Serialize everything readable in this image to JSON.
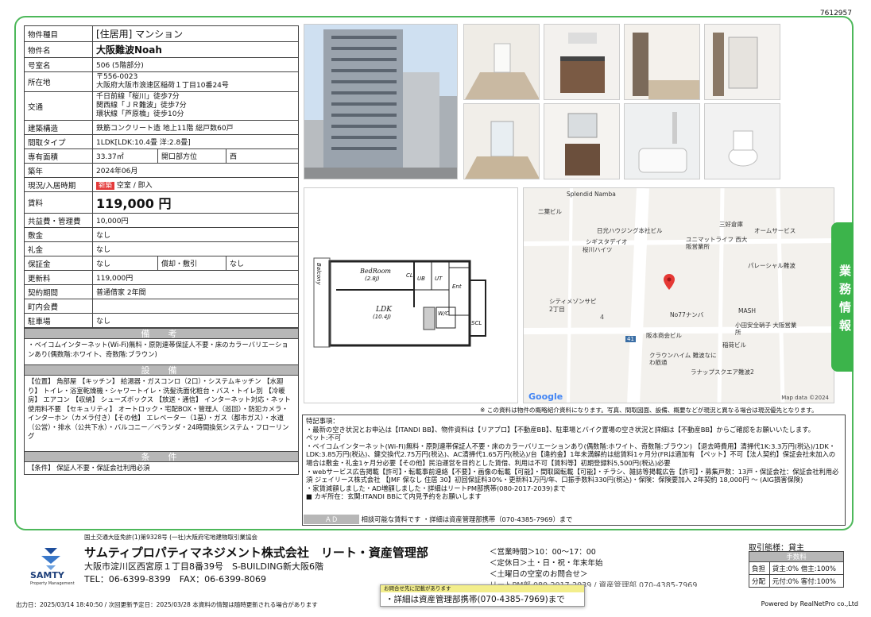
{
  "property_id": "7612957",
  "spec": {
    "rows": [
      {
        "k": "物件種目",
        "v": "[住居用] マンション"
      },
      {
        "k": "物件名",
        "v": "大阪難波Noah"
      },
      {
        "k": "号室名",
        "v": "506 (5階部分)"
      },
      {
        "k": "所在地",
        "v": "〒556-0023\n大阪府大阪市浪速区稲荷１丁目10番24号"
      },
      {
        "k": "交通",
        "v": "千日前線「桜川」徒歩7分\n関西線「ＪＲ難波」徒歩7分\n環状線「芦原橋」徒歩10分"
      },
      {
        "k": "建築構造",
        "v": "鉄筋コンクリート造 地上11階 総戸数60戸"
      },
      {
        "k": "間取タイプ",
        "v": "1LDK[LDK:10.4畳 洋:2.8畳]"
      }
    ],
    "area_label": "専有面積",
    "area": "33.37㎡",
    "dir_label": "開口部方位",
    "dir": "西",
    "built_label": "築年",
    "built": "2024年06月",
    "status_label": "現況/入居時期",
    "status_badge": "新築",
    "status": "空室 / 即入",
    "rent_label": "賃料",
    "rent": "119,000 円",
    "fee_label": "共益費・管理費",
    "fee": "10,000円",
    "deposit_label": "敷金",
    "deposit": "なし",
    "key_label": "礼金",
    "key": "なし",
    "hosho_label": "保証金",
    "hosho": "なし",
    "shokyaku_label": "償却・敷引",
    "shokyaku": "なし",
    "renew_label": "更新料",
    "renew": "119,000円",
    "contract_label": "契約期間",
    "contract": "普通借家 2年間",
    "town_label": "町内会費",
    "town": "",
    "parking_label": "駐車場",
    "parking": "なし"
  },
  "biko": {
    "title": "備　考",
    "text": "・ベイコムインターネット(Wi-Fi)無料・原則連帯保証人不要・床のカラーバリエーションあり(偶数階:ホワイト、奇数階:ブラウン)"
  },
  "setsubi": {
    "title": "設　備",
    "text": "【位置】 角部屋 【キッチン】 給湯器・ガスコンロ（2口）・システムキッチン 【水廻り】 トイレ・浴室乾燥機・シャワートイレ・洗髪洗面化粧台・バス・トイレ別 【冷暖房】 エアコン 【収納】 シューズボックス 【放送・通信】 インターネット対応・ネット使用料不要 【セキュリティ】 オートロック・宅配BOX・管理人（巡回）・防犯カメラ・インターホン（カメラ付き）【その他】 エレベーター（1基）・ガス（都市ガス）・水道（公営）・排水（公共下水）・バルコニー／ベランダ・24時間換気システム・フローリング"
  },
  "joken": {
    "title": "条　件",
    "text": "【条件】 保証人不要・保証会社利用必須"
  },
  "floorplan": {
    "bedroom": "BedRoom",
    "bedroom_size": "(2.8J)",
    "ldk": "LDK",
    "ldk_size": "(10.4J)",
    "cl": "CL",
    "ub": "UB",
    "ut": "UT",
    "ent": "Ent",
    "wc": "W/C",
    "scl": "SCL",
    "balcony": "Balcony"
  },
  "map": {
    "labels": [
      "Splendid Namba",
      "二葉ビル",
      "三好倉庫",
      "日光ハウジング本社ビル",
      "オームサービス",
      "シギスタデイオ",
      "ユニマットライフ 西大阪営業所",
      "桜川ハイツ",
      "パレーシャル難波",
      "シティメゾンサピ 2丁目",
      "No77ナンバ",
      "MASH",
      "阪本商会ビル",
      "小田安全硝子 大阪営業所",
      "稲荷ビル",
      "クラウンハイム 難波なにわ筋通",
      "ラナップスクエア難波2"
    ],
    "block": "4",
    "route": "41",
    "google": "Google",
    "credit": "Map data ©2024"
  },
  "disclaimer": "※ この資料は物件の概略紹介資料になります。写真、間取図面、設備、概要などが現況と異なる場合は現況優先となります。",
  "notes": {
    "title": "特記事項：",
    "lines": [
      "・最新の空き状況とお申込は【ITANDI BB】、物件資料は【リアプロ】【不動産BB】、駐車場とバイク置場の空き状況と詳細は【不動産BB】からご確認をお願いいたします。",
      "ペット:不可",
      "・ベイコムインターネット(Wi-Fi)無料・原則連帯保証人不要・床のカラーバリエーションあり(偶数階:ホワイト、奇数階:ブラウン) 【退去時費用】清掃代1K:3.3万円(税込)/1DK・LDK:3.85万円(税込)、鍵交換代2.75万円(税込)、AC清掃代1.65万円(税込)/台【違約金】1年未満解約は総賃料1ヶ月分(FRは適加有 【ペット】不可【法人契約】保証会社未加入の場合は敷金・礼金1ヶ月分必要【その他】民泊運営を目的とした賃借、利用は不可【賃料等】初期登録料5,500円(税込)必要",
      "・webサービス広告掲載【許可】・転載事前連絡【不要】・画像の転載【可能】・間取図転載【可能】・チラシ、雑誌等掲載広告【許可】・募集戸数：13戸・保証会社：保証会社利用必須 ジェイリース株式会社 【JMF 保なし 住居 30】初回保証料30%・更新料1万円/年、口振手数料330円(税込)・保険：保険要加入 2年契約 18,000円 〜 (AIG損害保険)",
      "・家賃減額しました・AD増額しました・詳細はリートPM部携帯(080-2017-2039)まで",
      "■ カギ所在：玄関:ITANDI BBにて内見予約をお願いします"
    ],
    "ad_label": "ＡＤ",
    "ad_text": "相談可能な賃料です ・詳細は資産管理部携帯（070-4385-7969）まで"
  },
  "company": {
    "license": "国土交通大臣免許(1)第9328号 (一社)大阪府宅地建物取引業協会",
    "logo_text": "SAMTY",
    "logo_sub": "Property Management",
    "name": "サムティプロパティマネジメント株式会社　リート・資産管理部",
    "address": "大阪市淀川区西宮原１丁目8番39号　S-BUILDING新大阪6階",
    "tel": "TEL：06-6399-8399　FAX：06-6399-8069",
    "hours": "＜営業時間＞10：00～17：00",
    "holiday": "＜定休日＞土・日・祝・年末年始",
    "weekend": "＜土曜日の空室のお問合せ＞",
    "weekend_line": "リートPM部 080-2017-2039 / 資産管理部 070-4385-7969"
  },
  "torihiki": {
    "title": "取引態様：貸主",
    "fee_title": "手数料",
    "r1_label": "負担",
    "r1": "貸主:0% 借主:100%",
    "r2_label": "分配",
    "r2": "元付:0% 客付:100%"
  },
  "popup": {
    "note": "お問合せ先に記載があります",
    "text": "・詳細は資産管理部携帯(070-4385-7969)まで"
  },
  "footer": {
    "left": "出力日：2025/03/14 18:40:50 / 次回更新予定日：2025/03/28 本資料の情報は随時更新される場合があります",
    "right": "Powered by RealNetPro co.,Ltd"
  },
  "side_tab": "業務情報",
  "colors": {
    "green": "#3cb44b",
    "header_gray": "#b7b7b7",
    "red_badge": "#e43a3a"
  }
}
